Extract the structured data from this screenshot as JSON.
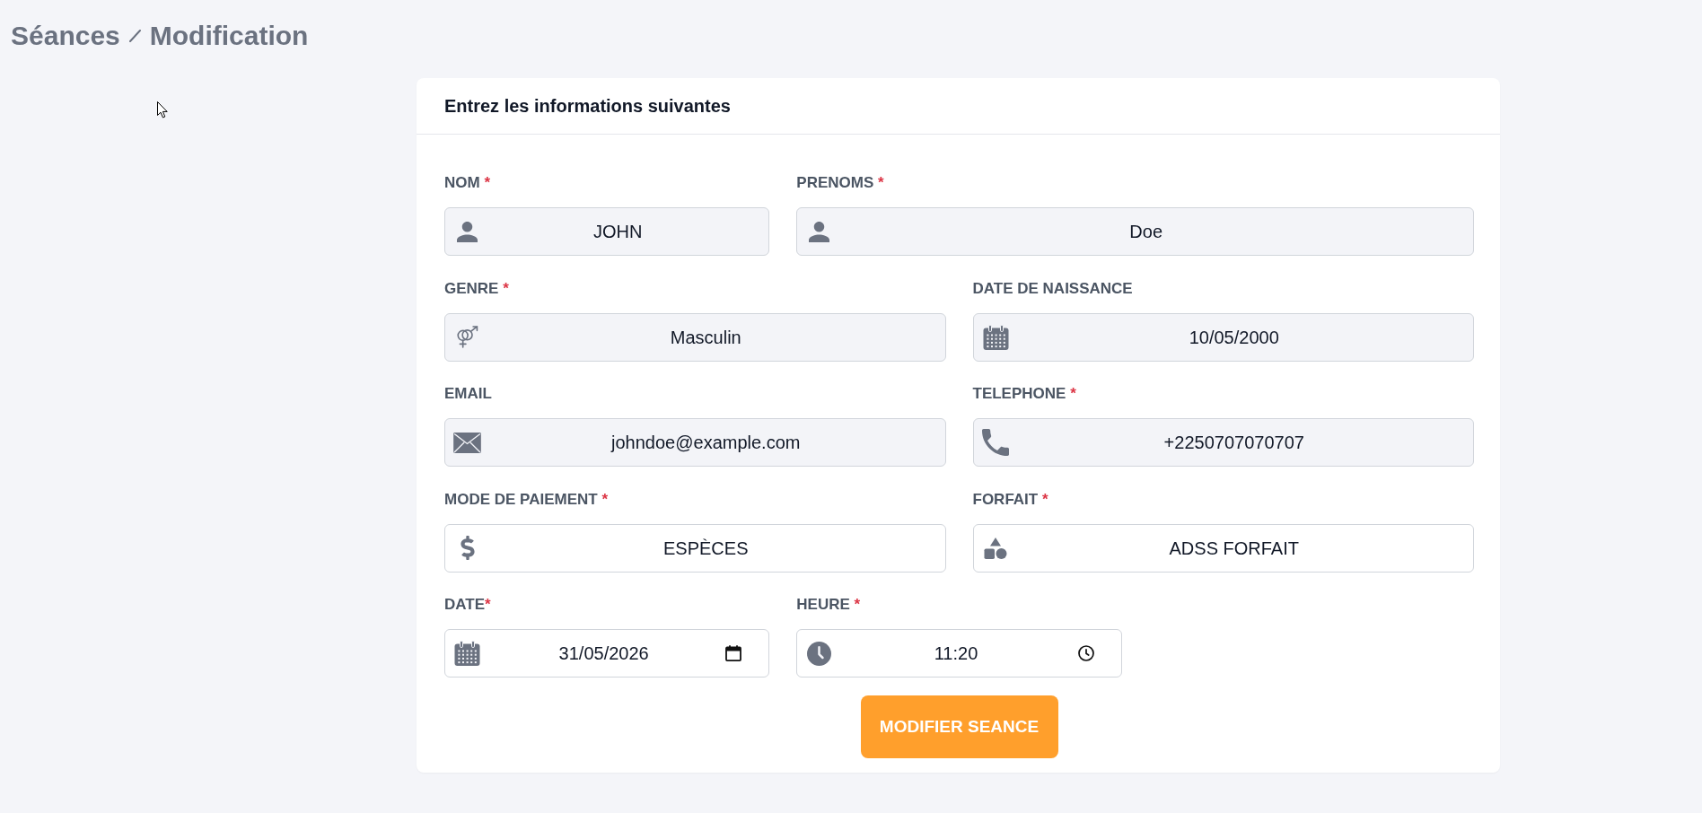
{
  "breadcrumb": {
    "items": [
      "Séances",
      "Modification"
    ]
  },
  "card": {
    "title": "Entrez les informations suivantes",
    "rows": [
      [
        {
          "label": "NOM",
          "required_mark": "*",
          "mark_spaced": true,
          "kind": "person",
          "value": "JOHN",
          "disabled": true
        },
        {
          "label": "PRENOMS",
          "required_mark": "*",
          "mark_spaced": true,
          "kind": "person",
          "value": "Doe",
          "disabled": true
        }
      ],
      [
        {
          "label": "GENRE",
          "required_mark": "*",
          "mark_spaced": true,
          "kind": "gender",
          "value": "Masculin",
          "disabled": true
        },
        {
          "label": "DATE DE NAISSANCE",
          "kind": "birthdate",
          "value": "10/05/2000",
          "disabled": true
        }
      ],
      [
        {
          "label": "EMAIL",
          "kind": "email",
          "value": "johndoe@example.com",
          "disabled": true
        },
        {
          "label": "TELEPHONE",
          "required_mark": "*",
          "mark_spaced": true,
          "kind": "phone",
          "value": "+2250707070707",
          "disabled": true
        }
      ],
      [
        {
          "label": "MODE DE PAIEMENT",
          "required_mark": "*",
          "mark_spaced": true,
          "kind": "payment",
          "value": "ESPÈCES",
          "disabled": false
        },
        {
          "label": "FORFAIT",
          "required_mark": "*",
          "mark_spaced": true,
          "kind": "package",
          "value": "ADSS FORFAIT",
          "disabled": false
        }
      ],
      [
        {
          "label": "DATE",
          "required_mark": "*",
          "mark_spaced": false,
          "kind": "date",
          "value": "31/05/2026",
          "disabled": false
        },
        {
          "label": "HEURE",
          "required_mark": "*",
          "mark_spaced": true,
          "kind": "time",
          "value": "11:20",
          "disabled": false
        }
      ]
    ],
    "submit_button": {
      "label": "MODIFIER SEANCE"
    }
  }
}
